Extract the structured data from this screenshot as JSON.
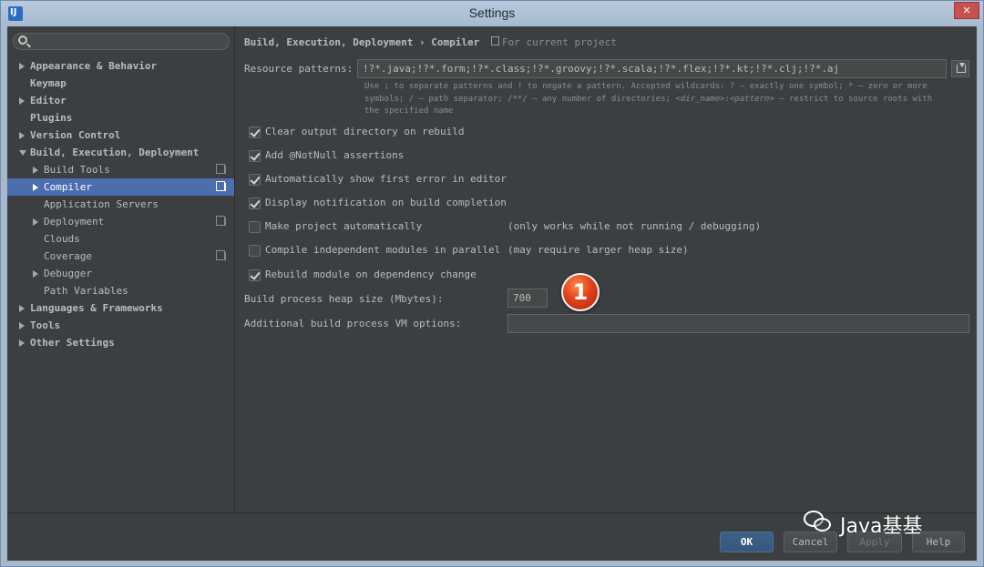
{
  "window": {
    "title": "Settings",
    "app_icon_letter": "IJ",
    "close_label": "✕"
  },
  "sidebar": {
    "search_placeholder": "",
    "items": [
      {
        "label": "Appearance & Behavior",
        "arrow": "right",
        "level": 0
      },
      {
        "label": "Keymap",
        "arrow": "none",
        "level": 0
      },
      {
        "label": "Editor",
        "arrow": "right",
        "level": 0
      },
      {
        "label": "Plugins",
        "arrow": "none",
        "level": 0
      },
      {
        "label": "Version Control",
        "arrow": "right",
        "level": 0
      },
      {
        "label": "Build, Execution, Deployment",
        "arrow": "down",
        "level": 0
      },
      {
        "label": "Build Tools",
        "arrow": "right",
        "level": 1,
        "copy_icon": true
      },
      {
        "label": "Compiler",
        "arrow": "right",
        "level": 1,
        "copy_icon": true,
        "selected": true
      },
      {
        "label": "Application Servers",
        "arrow": "none",
        "level": 1
      },
      {
        "label": "Deployment",
        "arrow": "right",
        "level": 1,
        "copy_icon": true
      },
      {
        "label": "Clouds",
        "arrow": "none",
        "level": 1
      },
      {
        "label": "Coverage",
        "arrow": "none",
        "level": 1,
        "copy_icon": true
      },
      {
        "label": "Debugger",
        "arrow": "right",
        "level": 1
      },
      {
        "label": "Path Variables",
        "arrow": "none",
        "level": 1
      },
      {
        "label": "Languages & Frameworks",
        "arrow": "right",
        "level": 0
      },
      {
        "label": "Tools",
        "arrow": "right",
        "level": 0
      },
      {
        "label": "Other Settings",
        "arrow": "right",
        "level": 0
      }
    ]
  },
  "main": {
    "breadcrumb": "Build, Execution, Deployment › Compiler",
    "for_project": "For current project",
    "resource_patterns_label": "Resource patterns:",
    "resource_patterns_value": "!?*.java;!?*.form;!?*.class;!?*.groovy;!?*.scala;!?*.flex;!?*.kt;!?*.clj;!?*.aj",
    "hint_1": "Use ; to separate patterns and ! to negate a pattern. Accepted wildcards: ? — exactly one symbol; * — zero or more",
    "hint_2a": "symbols; / — path separator; /**/ — any number of directories; ",
    "hint_2b": "<dir_name>:<pattern>",
    "hint_2c": " — restrict to source roots with",
    "hint_3": "the specified name",
    "options": [
      {
        "label": "Clear output directory on rebuild",
        "checked": true,
        "note": ""
      },
      {
        "label": "Add @NotNull assertions",
        "checked": true,
        "note": ""
      },
      {
        "label": "Automatically show first error in editor",
        "checked": true,
        "note": ""
      },
      {
        "label": "Display notification on build completion",
        "checked": true,
        "note": ""
      },
      {
        "label": "Make project automatically",
        "checked": false,
        "note": "(only works while not running / debugging)"
      },
      {
        "label": "Compile independent modules in parallel",
        "checked": false,
        "note": "(may require larger heap size)"
      },
      {
        "label": "Rebuild module on dependency change",
        "checked": true,
        "note": ""
      }
    ],
    "heap_label": "Build process heap size (Mbytes):",
    "heap_value": "700",
    "vm_options_label": "Additional build process VM options:",
    "vm_options_value": "",
    "badge_number": "1"
  },
  "footer": {
    "ok": "OK",
    "cancel": "Cancel",
    "apply": "Apply",
    "help": "Help"
  },
  "watermark": {
    "text": "Java基基"
  }
}
